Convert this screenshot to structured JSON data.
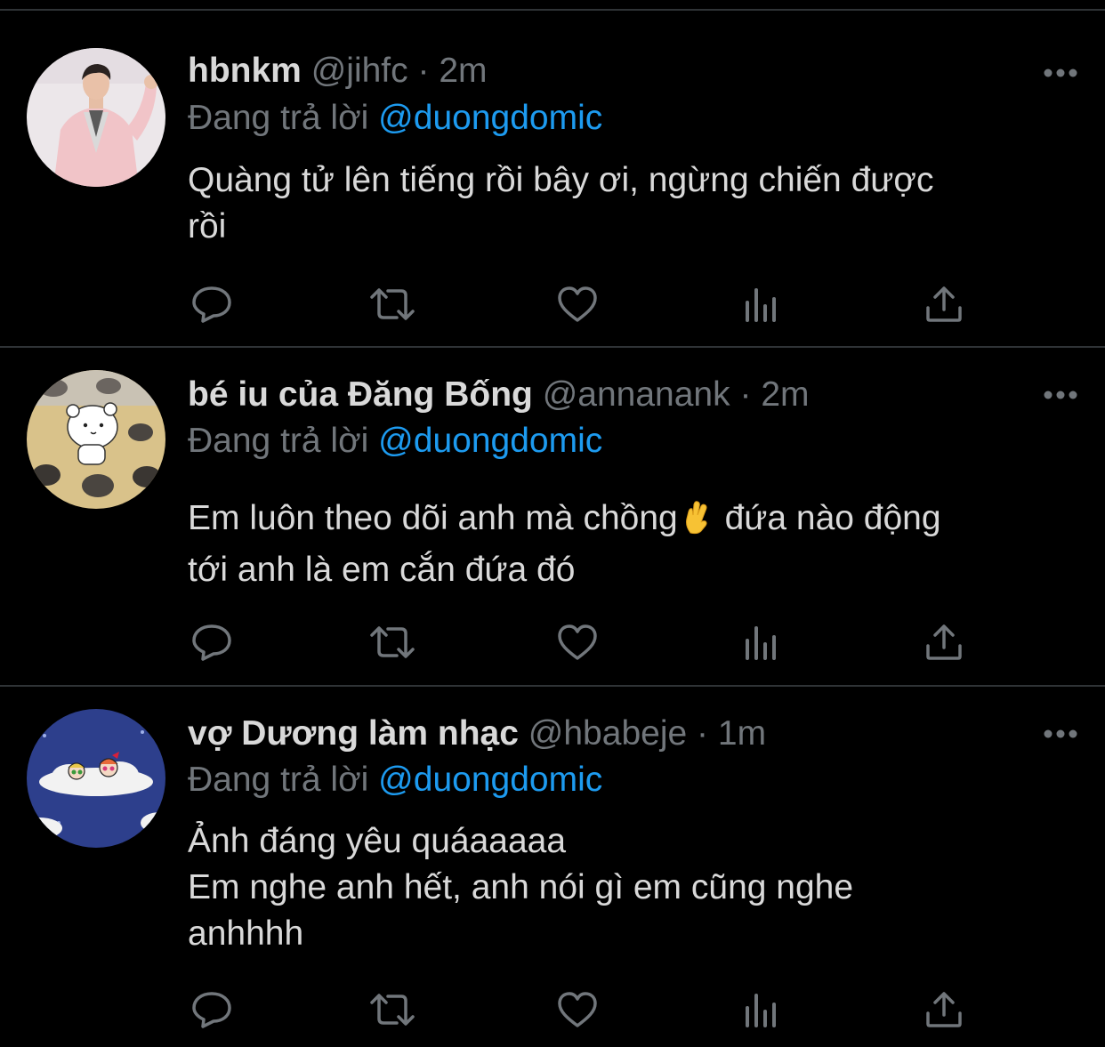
{
  "tweets": [
    {
      "display_name": "hbnkm",
      "handle": "@jihfc",
      "separator": "·",
      "time": "2m",
      "reply_prefix": "Đang trả lời",
      "reply_to": "@duongdomic",
      "text_lines": [
        "Quàng tử lên tiếng rồi bây ơi, ngừng chiến được",
        "rồi"
      ],
      "avatar_icon": "person-in-pink-suit-photo"
    },
    {
      "display_name": "bé iu của Đăng Bống",
      "handle": "@annanank",
      "separator": "·",
      "time": "2m",
      "reply_prefix": "Đang trả lời",
      "reply_to": "@duongdomic",
      "text_line1_before": "Em luôn theo dõi anh mà chồng",
      "text_line1_after": "đứa nào động",
      "text_line2": "tới anh là em cắn đứa đó",
      "emoji_icon": "crossed-fingers-emoji",
      "avatar_icon": "cartoon-white-bear"
    },
    {
      "display_name": "vợ Dương làm nhạc",
      "handle": "@hbabeje",
      "separator": "·",
      "time": "1m",
      "reply_prefix": "Đang trả lời",
      "reply_to": "@duongdomic",
      "text_lines": [
        "Ảnh đáng yêu quáaaaaa",
        "Em nghe anh hết, anh nói gì em cũng nghe",
        "anhhhh"
      ],
      "avatar_icon": "powerpuff-girls-on-cloud"
    }
  ],
  "icons": {
    "more": "more-horizontal-icon",
    "reply": "reply-bubble-icon",
    "retweet": "retweet-icon",
    "like": "heart-icon",
    "views": "views-bar-chart-icon",
    "share": "share-upload-icon"
  },
  "colors": {
    "background": "#000000",
    "text": "#d9d9d9",
    "secondary": "#71767b",
    "link": "#1d9bf0",
    "divider": "#2f3336"
  }
}
